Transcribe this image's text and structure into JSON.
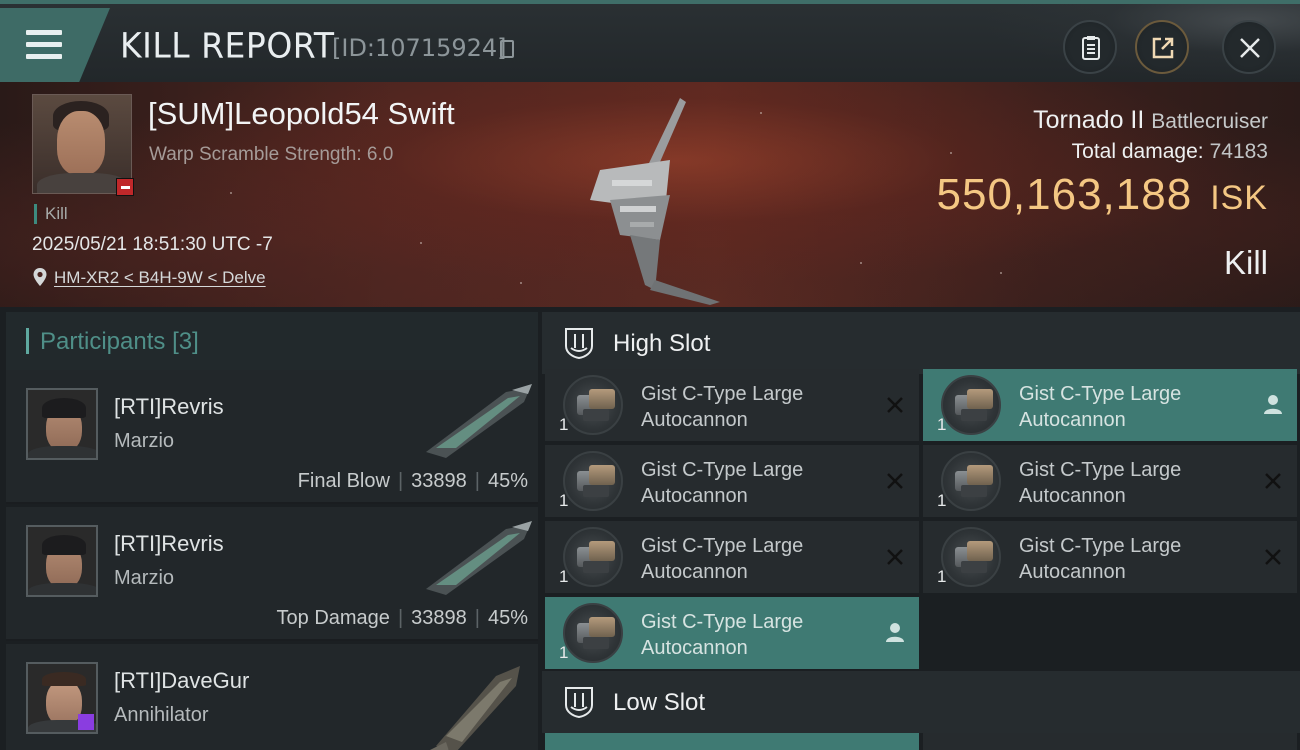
{
  "header": {
    "title": "KILL REPORT",
    "report_id": "[ID:10715924]",
    "icons": [
      "menu-icon",
      "copy-icon",
      "clipboard-icon",
      "share-icon",
      "close-icon"
    ]
  },
  "victim": {
    "name": "[SUM]Leopold54 Swift",
    "scramble": "Warp Scramble Strength: 6.0",
    "kill_tag": "Kill",
    "datetime": "2025/05/21 18:51:30 UTC -7",
    "location": "HM-XR2 < B4H-9W < Delve",
    "ship_name": "Tornado II",
    "ship_class": "Battlecruiser",
    "total_damage_label": "Total damage:",
    "total_damage": "74183",
    "isk_value": "550,163,188",
    "isk_unit": "ISK",
    "result": "Kill"
  },
  "participants": {
    "label": "Participants",
    "count": "[3]",
    "rows": [
      {
        "name": "[RTI]Revris",
        "ship": "Marzio",
        "role": "Final Blow",
        "damage": "33898",
        "percent": "45%"
      },
      {
        "name": "[RTI]Revris",
        "ship": "Marzio",
        "role": "Top Damage",
        "damage": "33898",
        "percent": "45%"
      },
      {
        "name": "[RTI]DaveGur",
        "ship": "Annihilator",
        "role": "",
        "damage": "",
        "percent": ""
      }
    ]
  },
  "fitting": {
    "high_slot_label": "High Slot",
    "low_slot_label": "Low Slot",
    "high_slots": [
      {
        "qty": "1",
        "line1": "Gist C-Type Large",
        "line2": "Autocannon",
        "status": "destroyed",
        "highlight": false
      },
      {
        "qty": "1",
        "line1": "Gist C-Type Large",
        "line2": "Autocannon",
        "status": "dropped",
        "highlight": true
      },
      {
        "qty": "1",
        "line1": "Gist C-Type Large",
        "line2": "Autocannon",
        "status": "destroyed",
        "highlight": false
      },
      {
        "qty": "1",
        "line1": "Gist C-Type Large",
        "line2": "Autocannon",
        "status": "destroyed",
        "highlight": false
      },
      {
        "qty": "1",
        "line1": "Gist C-Type Large",
        "line2": "Autocannon",
        "status": "destroyed",
        "highlight": false
      },
      {
        "qty": "1",
        "line1": "Gist C-Type Large",
        "line2": "Autocannon",
        "status": "destroyed",
        "highlight": false
      },
      {
        "qty": "1",
        "line1": "Gist C-Type Large",
        "line2": "Autocannon",
        "status": "dropped",
        "highlight": true
      }
    ]
  },
  "colors": {
    "accent_teal": "#3f7a73",
    "isk_gold": "#f4c783",
    "corp_red": "#c0282a"
  }
}
